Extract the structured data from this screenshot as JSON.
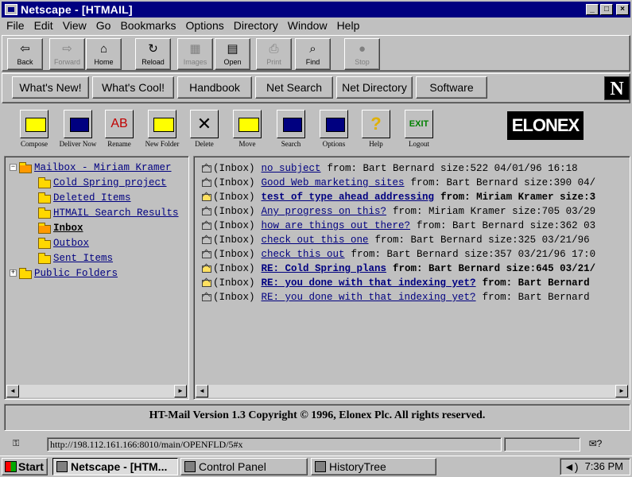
{
  "window": {
    "title": "Netscape - [HTMAIL]",
    "buttons": {
      "minimize": "_",
      "maximize": "□",
      "close": "×"
    }
  },
  "menu": [
    "File",
    "Edit",
    "View",
    "Go",
    "Bookmarks",
    "Options",
    "Directory",
    "Window",
    "Help"
  ],
  "nav_toolbar": [
    {
      "label": "Back",
      "icon": "back-arrow-icon",
      "glyph": "⇦",
      "enabled": true
    },
    {
      "label": "Forward",
      "icon": "forward-arrow-icon",
      "glyph": "⇨",
      "enabled": false
    },
    {
      "label": "Home",
      "icon": "home-icon",
      "glyph": "⌂",
      "enabled": true
    },
    {
      "label": "Reload",
      "icon": "reload-icon",
      "glyph": "↻",
      "enabled": true
    },
    {
      "label": "Images",
      "icon": "images-icon",
      "glyph": "▦",
      "enabled": false
    },
    {
      "label": "Open",
      "icon": "open-icon",
      "glyph": "▤",
      "enabled": true
    },
    {
      "label": "Print",
      "icon": "print-icon",
      "glyph": "⎙",
      "enabled": false
    },
    {
      "label": "Find",
      "icon": "find-icon",
      "glyph": "⌕",
      "enabled": true
    },
    {
      "label": "Stop",
      "icon": "stop-icon",
      "glyph": "●",
      "enabled": false
    }
  ],
  "directory_buttons": [
    "What's New!",
    "What's Cool!",
    "Handbook",
    "Net Search",
    "Net Directory",
    "Software"
  ],
  "netscape_logo": "N",
  "mail_toolbar": [
    {
      "label": "Compose",
      "icon": "compose-envelope-icon"
    },
    {
      "label": "Deliver Now",
      "icon": "deliver-now-icon"
    },
    {
      "label": "Rename",
      "icon": "rename-icon"
    },
    {
      "label": "New Folder",
      "icon": "new-folder-icon"
    },
    {
      "label": "Delete",
      "icon": "delete-x-icon"
    },
    {
      "label": "Move",
      "icon": "move-icon"
    },
    {
      "label": "Search",
      "icon": "search-icon"
    },
    {
      "label": "Options",
      "icon": "options-icon"
    },
    {
      "label": "Help",
      "icon": "help-question-icon"
    },
    {
      "label": "Logout",
      "icon": "exit-icon"
    }
  ],
  "mail_toolbar_glyphs": {
    "rename": "AB",
    "delete": "✕",
    "help": "?",
    "logout": "EXIT"
  },
  "elonex_logo": "ELONEX",
  "folders": [
    {
      "label": "Mailbox - Miriam Kramer",
      "indent": 0,
      "expander": "−",
      "open": true,
      "bold": false
    },
    {
      "label": "Cold Spring project",
      "indent": 1,
      "expander": "",
      "open": false,
      "bold": false
    },
    {
      "label": "Deleted Items",
      "indent": 1,
      "expander": "",
      "open": false,
      "bold": false
    },
    {
      "label": "HTMAIL Search Results",
      "indent": 1,
      "expander": "",
      "open": false,
      "bold": false
    },
    {
      "label": "Inbox",
      "indent": 1,
      "expander": "",
      "open": true,
      "bold": true
    },
    {
      "label": "Outbox",
      "indent": 1,
      "expander": "",
      "open": false,
      "bold": false
    },
    {
      "label": "Sent Items",
      "indent": 1,
      "expander": "",
      "open": false,
      "bold": false
    },
    {
      "label": "Public Folders",
      "indent": 0,
      "expander": "+",
      "open": false,
      "bold": false
    }
  ],
  "messages": [
    {
      "folder": "(Inbox)",
      "subject": "no subject",
      "meta": "from: Bart Bernard size:522 04/01/96 16:18",
      "unread": false
    },
    {
      "folder": "(Inbox)",
      "subject": "Good Web marketing sites",
      "meta": "from: Bart Bernard size:390 04/",
      "unread": false
    },
    {
      "folder": "(Inbox)",
      "subject": "test of type ahead addressing",
      "meta": "from: Miriam Kramer size:3",
      "unread": true
    },
    {
      "folder": "(Inbox)",
      "subject": "Any progress on this?",
      "meta": "from: Miriam Kramer size:705 03/29",
      "unread": false
    },
    {
      "folder": "(Inbox)",
      "subject": "how are things out there?",
      "meta": "from: Bart Bernard size:362 03",
      "unread": false
    },
    {
      "folder": "(Inbox)",
      "subject": "check out this one",
      "meta": "from: Bart Bernard size:325 03/21/96",
      "unread": false
    },
    {
      "folder": "(Inbox)",
      "subject": "check this out",
      "meta": "from: Bart Bernard size:357 03/21/96 17:0",
      "unread": false
    },
    {
      "folder": "(Inbox)",
      "subject": "RE: Cold Spring plans",
      "meta": "from: Bart Bernard size:645 03/21/",
      "unread": true
    },
    {
      "folder": "(Inbox)",
      "subject": "RE: you done with that indexing yet?",
      "meta": "from: Bart Bernard",
      "unread": true
    },
    {
      "folder": "(Inbox)",
      "subject": "RE: you done with that indexing yet?",
      "meta": "from: Bart Bernard",
      "unread": false
    }
  ],
  "scroll_arrows": {
    "left": "◄",
    "right": "►"
  },
  "footer": "HT-Mail Version 1.3 Copyright © 1996, Elonex Plc. All rights reserved.",
  "status": {
    "url": "http://198.112.161.166:8010/main/OPENFLD/5#x",
    "security_glyph": "⚿",
    "mail_glyph": "✉?"
  },
  "taskbar": {
    "start": "Start",
    "tasks": [
      {
        "label": "Netscape - [HTM...",
        "active": true
      },
      {
        "label": "Control Panel",
        "active": false
      },
      {
        "label": "HistoryTree",
        "active": false
      }
    ],
    "speaker_glyph": "◄)",
    "clock": "7:36 PM"
  }
}
